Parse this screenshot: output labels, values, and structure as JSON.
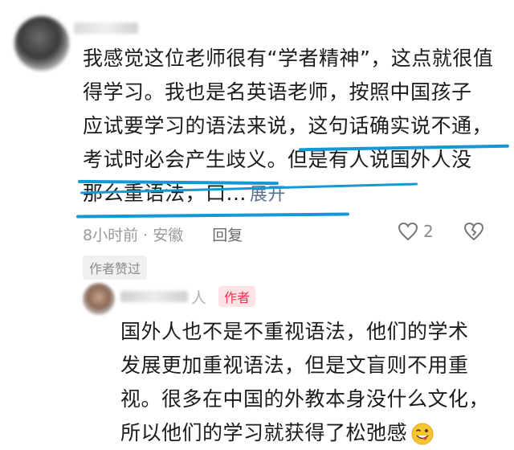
{
  "comment": {
    "lines": [
      "我感觉这位老师很有“学者精神”，这点就很值",
      "得学习。我也是名英语老师，按照中国孩子",
      "应试要学习的语法来说，这句话确实说不通，",
      "考试时必会产生歧义。但是有人说国外人没",
      "那么重语法，口..."
    ],
    "expand_label": "展开",
    "time": "8小时前",
    "location": "安徽",
    "separator": " · ",
    "reply_label": "回复",
    "like_count": "2",
    "author_liked": "作者赞过"
  },
  "reply": {
    "name_tail": "人",
    "author_badge": "作者",
    "lines": [
      "国外人也不是不重视语法，他们的学术",
      "发展更加重视语法，但是文盲则不用重",
      "视。很多在中国的外教本身没什么文化，",
      "所以他们的学习就获得了松弛感"
    ],
    "emoji": "winking-face-with-tongue-icon"
  },
  "colors": {
    "underline": "#1798d6",
    "author_badge_bg": "#fde3e6",
    "author_badge_text": "#e5384f",
    "link": "#5a6e8c"
  }
}
